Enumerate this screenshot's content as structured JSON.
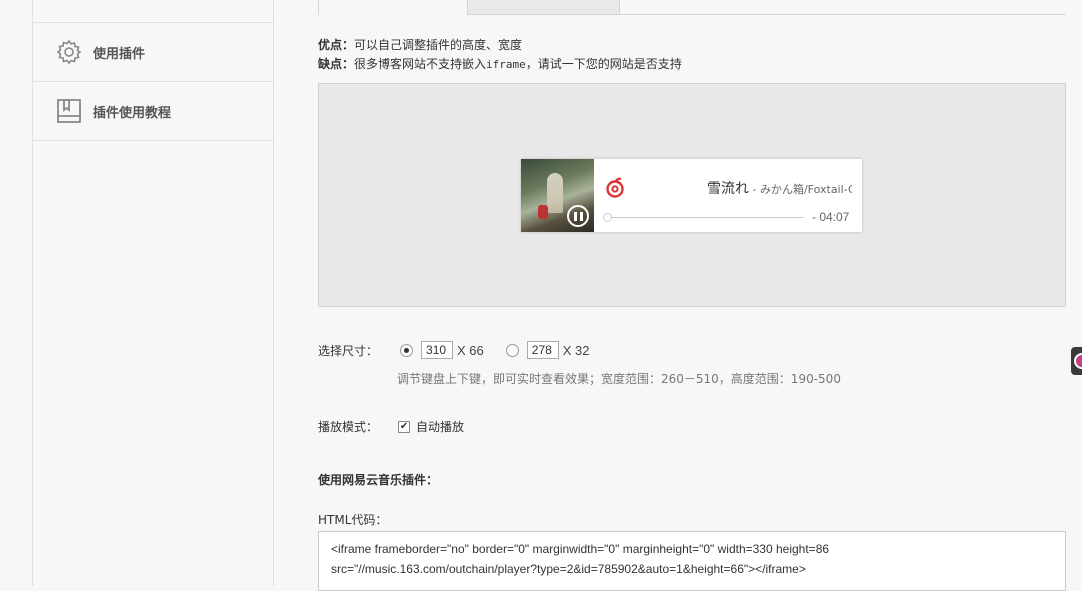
{
  "sidebar": {
    "items": [
      {
        "label": "使用插件",
        "icon": "gear-icon"
      },
      {
        "label": "插件使用教程",
        "icon": "book-icon"
      }
    ]
  },
  "notes": {
    "pros_label": "优点：",
    "pros_text": "可以自己调整插件的高度、宽度",
    "cons_label": "缺点：",
    "cons_text_1": "很多博客网站不支持嵌入",
    "cons_code": "iframe",
    "cons_text_2": "，请试一下您的网站是否支持"
  },
  "player": {
    "song_title": "雪流れ",
    "artist": " - みかん箱/Foxtail-Grass Studio",
    "time": "- 04:07",
    "progress": 0
  },
  "size": {
    "label": "选择尺寸：",
    "option1_width": "310",
    "option1_height": "X 66",
    "option2_width": "278",
    "option2_height": "X 32",
    "selected": "option1",
    "hint": "调节键盘上下键，即可实时查看效果；宽度范围：260－510，高度范围：190-500"
  },
  "mode": {
    "label": "播放模式：",
    "autoplay_label": "自动播放",
    "autoplay": true
  },
  "usage": {
    "heading": "使用网易云音乐插件：",
    "html_label": "HTML代码：",
    "code_line1": "<iframe frameborder=\"no\" border=\"0\" marginwidth=\"0\" marginheight=\"0\" width=330 height=86",
    "code_line2": "src=\"//music.163.com/outchain/player?type=2&id=785902&auto=1&height=66\"></iframe>"
  },
  "colors": {
    "accent_red": "#e03232",
    "background": "#f7f7f7"
  }
}
